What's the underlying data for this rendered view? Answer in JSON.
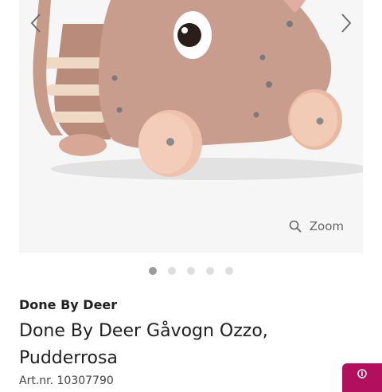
{
  "gallery": {
    "image_alt": "Done By Deer Gåvogn Ozzo, Pudderrosa",
    "prev_icon": "chevron-left-icon",
    "next_icon": "chevron-right-icon",
    "zoom_icon": "search-icon",
    "zoom_label": "Zoom",
    "dot_count": 5,
    "active_dot": 1
  },
  "product": {
    "brand": "Done By Deer",
    "title": "Done By Deer Gåvogn Ozzo, Pudderrosa",
    "article_number": "Art.nr. 10307790"
  },
  "chat": {
    "icon": "chat-icon"
  },
  "colors": {
    "accent": "#b2105e",
    "product_pink": "#c99d8d",
    "wheel": "#f0c5b0",
    "gallery_bg": "#f6f6f6"
  }
}
